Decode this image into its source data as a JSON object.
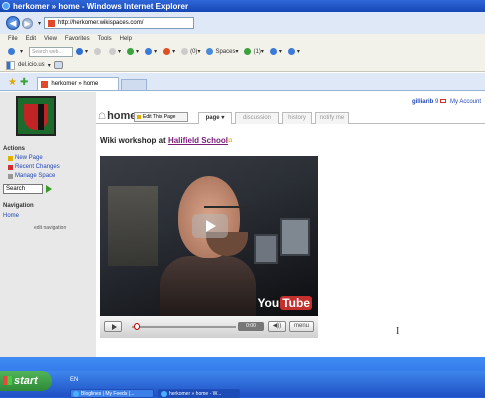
{
  "window": {
    "title": "herkomer » home - Windows Internet Explorer"
  },
  "address": {
    "url": "http://herkomer.wikispaces.com/"
  },
  "menubar": {
    "items": [
      "File",
      "Edit",
      "View",
      "Favorites",
      "Tools",
      "Help"
    ]
  },
  "toolbar": {
    "search_placeholder": "Search web...",
    "mail_count": "(0)",
    "spaces_label": "Spaces",
    "contacts_count": "(1)"
  },
  "delicious": {
    "label": "del.icio.us"
  },
  "tabs": {
    "active_label": "herkomer » home"
  },
  "sidebar": {
    "actions_heading": "Actions",
    "actions": [
      "New Page",
      "Recent Changes",
      "Manage Space"
    ],
    "search_value": "Search",
    "navigation_heading": "Navigation",
    "nav_item": "Home",
    "edit_navigation": "edit navigation"
  },
  "userbar": {
    "username": "gilliarib",
    "mail_count": "9",
    "account": "My Account"
  },
  "wiki": {
    "page_title": "home",
    "edit_button": "Edit This Page",
    "tabs": [
      "page",
      "discussion",
      "history",
      "notify me"
    ]
  },
  "content": {
    "heading_prefix": "Wiki workshop at ",
    "heading_link": "Halifield School",
    "heading_mark": "¤"
  },
  "video": {
    "logo_you": "You",
    "logo_tube": "Tube",
    "time": "0:00",
    "menu_label": "menu",
    "volume_label": "◀))"
  },
  "taskbar": {
    "start_label": "start",
    "language": "EN",
    "tasks": [
      "Bloglines | My Feeds (...",
      "herkomer » home - W..."
    ]
  }
}
